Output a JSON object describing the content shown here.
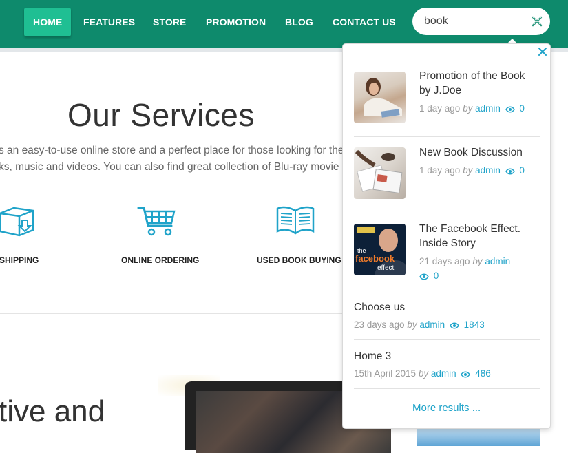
{
  "nav": {
    "items": [
      {
        "label": "HOME",
        "active": true
      },
      {
        "label": "FEATURES"
      },
      {
        "label": "STORE"
      },
      {
        "label": "PROMOTION"
      },
      {
        "label": "BLOG"
      },
      {
        "label": "CONTACT US"
      }
    ]
  },
  "search": {
    "value": "book"
  },
  "services": {
    "title": "Our Services",
    "line1": "s an easy-to-use online store and a perfect place for those looking for the",
    "line2": "ks, music and videos. You can also find great collection of Blu-ray movie",
    "items": [
      {
        "label": "SHIPPING",
        "icon": "box-download-icon"
      },
      {
        "label": "ONLINE ORDERING",
        "icon": "shopping-cart-icon"
      },
      {
        "label": "USED BOOK BUYING",
        "icon": "open-book-icon"
      }
    ]
  },
  "hero": {
    "text": "tive and"
  },
  "dropdown": {
    "results": [
      {
        "title_line1": "Promotion of the Book",
        "title_line2": "by J.Doe",
        "date": "1 day ago",
        "by": "by",
        "author": "admin",
        "views": "0"
      },
      {
        "title_line1": "New Book Discussion",
        "date": "1 day ago",
        "by": "by",
        "author": "admin",
        "views": "0"
      },
      {
        "title_line1": "The Facebook Effect.",
        "title_line2": "Inside Story",
        "date": "21 days ago",
        "by": "by",
        "author": "admin",
        "views": "0",
        "thumb_text": [
          "the",
          "facebook",
          "effect"
        ]
      },
      {
        "title_line1": "Choose us",
        "date": "23 days ago",
        "by": "by",
        "author": "admin",
        "views": "1843"
      },
      {
        "title_line1": "Home 3",
        "date": "15th April 2015",
        "by": "by",
        "author": "admin",
        "views": "486"
      }
    ],
    "more": "More results ..."
  },
  "colors": {
    "nav": "#0e8a6c",
    "active": "#1fbf93",
    "accent": "#1fa3c9"
  }
}
